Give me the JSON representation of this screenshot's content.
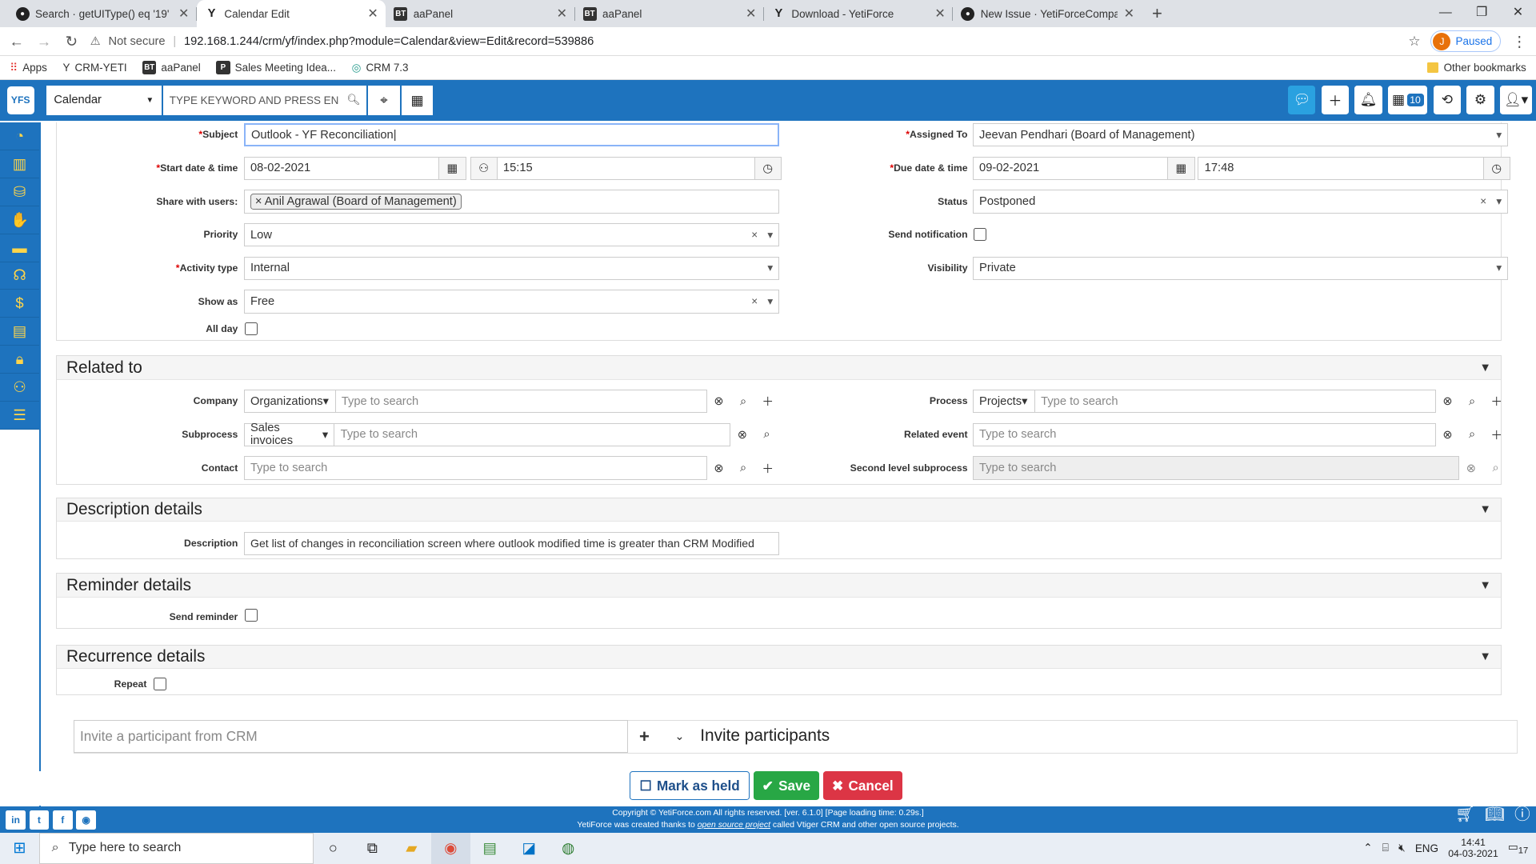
{
  "browser": {
    "tabs": [
      {
        "icon": "github-icon",
        "title": "Search · getUIType() eq '19'"
      },
      {
        "icon": "yetiforce-icon",
        "title": "Calendar Edit"
      },
      {
        "icon": "bt-icon",
        "title": "aaPanel"
      },
      {
        "icon": "bt-icon",
        "title": "aaPanel"
      },
      {
        "icon": "yetiforce-icon",
        "title": "Download - YetiForce"
      },
      {
        "icon": "github-icon",
        "title": "New Issue · YetiForceCompany/Ye"
      }
    ],
    "not_secure": "Not secure",
    "url": "192.168.1.244/crm/yf/index.php?module=Calendar&view=Edit&record=539886",
    "profile_initial": "J",
    "profile_status": "Paused",
    "bookmarks": [
      "Apps",
      "CRM-YETI",
      "aaPanel",
      "Sales Meeting Idea...",
      "CRM 7.3"
    ],
    "other_bookmarks": "Other bookmarks"
  },
  "header": {
    "module": "Calendar",
    "search_placeholder": "TYPE KEYWORD AND PRESS EN",
    "reminder_count": "10"
  },
  "form": {
    "subject_label": "Subject",
    "subject_value": "Outlook - YF Reconciliation",
    "assigned_label": "Assigned To",
    "assigned_value": "Jeevan Pendhari (Board of Management)",
    "start_label": "Start date & time",
    "start_date": "08-02-2021",
    "start_time": "15:15",
    "due_label": "Due date & time",
    "due_date": "09-02-2021",
    "due_time": "17:48",
    "share_label": "Share with users:",
    "share_value": "Anil Agrawal (Board of Management)",
    "status_label": "Status",
    "status_value": "Postponed",
    "priority_label": "Priority",
    "priority_value": "Low",
    "notify_label": "Send notification",
    "activity_label": "Activity type",
    "activity_value": "Internal",
    "visibility_label": "Visibility",
    "visibility_value": "Private",
    "showas_label": "Show as",
    "showas_value": "Free",
    "allday_label": "All day"
  },
  "related": {
    "title": "Related to",
    "company_label": "Company",
    "company_module": "Organizations",
    "process_label": "Process",
    "process_module": "Projects",
    "subprocess_label": "Subprocess",
    "subprocess_module": "Sales invoices",
    "related_event_label": "Related event",
    "contact_label": "Contact",
    "second_level_label": "Second level subprocess",
    "placeholder": "Type to search"
  },
  "description": {
    "title": "Description details",
    "label": "Description",
    "value": "Get list of changes in reconciliation screen where outlook modified time is greater than CRM Modified"
  },
  "reminder": {
    "title": "Reminder details",
    "label": "Send reminder"
  },
  "recurrence": {
    "title": "Recurrence details",
    "label": "Repeat"
  },
  "invite": {
    "placeholder": "Invite a participant from CRM",
    "title": "Invite participants"
  },
  "actions": {
    "held": "Mark as held",
    "save": "Save",
    "cancel": "Cancel"
  },
  "footer": {
    "line1": "Copyright © YetiForce.com All rights reserved. [ver. 6.1.0] [Page loading time: 0.29s.]",
    "line2a": "YetiForce was created thanks to ",
    "line2link": "open source project",
    "line2b": " called Vtiger CRM and other open source projects."
  },
  "taskbar": {
    "search_placeholder": "Type here to search",
    "lang": "ENG",
    "time": "14:41",
    "date": "04-03-2021",
    "notifications": "17"
  }
}
